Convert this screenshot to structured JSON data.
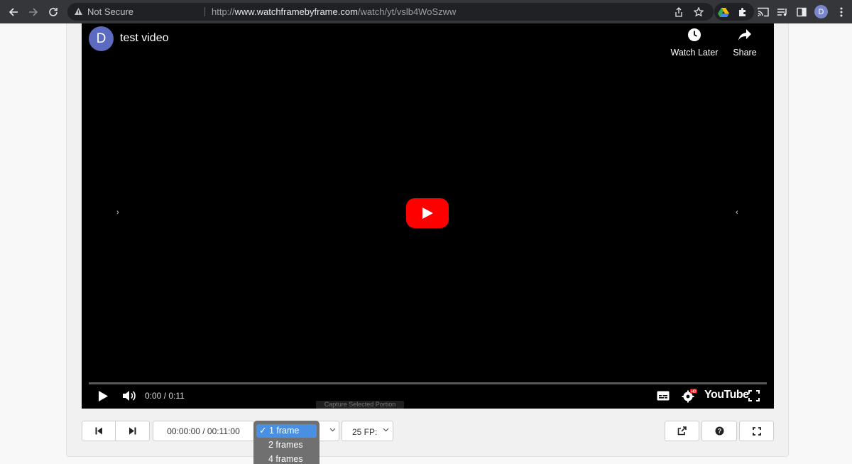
{
  "browser": {
    "security_label": "Not Secure",
    "url_scheme": "http://",
    "url_host": "www.watchframebyframe.com",
    "url_path": "/watch/yt/vslb4WoSzww",
    "profile_initial": "D"
  },
  "player": {
    "channel_initial": "D",
    "video_title": "test video",
    "watch_later_label": "Watch Later",
    "share_label": "Share",
    "time_display": "0:00 / 0:11",
    "capture_label": "Capture Selected Portion",
    "brand_label": "YouTube"
  },
  "controls": {
    "timecode": "00:00:00 / 00:11:00",
    "fps_value": "25 FP:",
    "step_options": [
      "1 frame",
      "2 frames",
      "4 frames"
    ],
    "step_selected": "✓ 1 frame"
  },
  "colors": {
    "play_red": "#ff0000",
    "selection_blue": "#4a90e2",
    "channel_avatar": "#5c6bc0"
  }
}
